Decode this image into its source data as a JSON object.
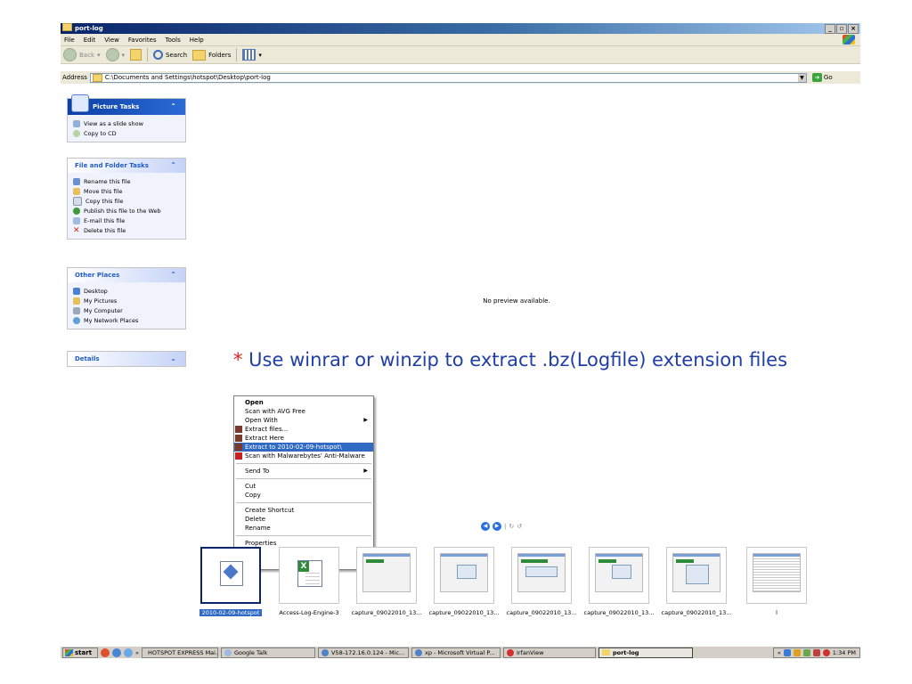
{
  "window": {
    "title": "port-log",
    "controls": [
      "_",
      "×"
    ]
  },
  "menu": [
    "File",
    "Edit",
    "View",
    "Favorites",
    "Tools",
    "Help"
  ],
  "toolbar": {
    "back": "Back",
    "search": "Search",
    "folders": "Folders"
  },
  "address": {
    "label": "Address",
    "path": "C:\\Documents and Settings\\hotspot\\Desktop\\port-log",
    "go": "Go"
  },
  "picture_tasks": {
    "title": "Picture Tasks",
    "items": [
      "View as a slide show",
      "Copy to CD"
    ]
  },
  "file_tasks": {
    "title": "File and Folder Tasks",
    "items": [
      "Rename this file",
      "Move this file",
      "Copy this file",
      "Publish this file to the Web",
      "E-mail this file",
      "Delete this file"
    ]
  },
  "other_places": {
    "title": "Other Places",
    "items": [
      "Desktop",
      "My Pictures",
      "My Computer",
      "My Network Places"
    ]
  },
  "details": {
    "title": "Details"
  },
  "preview": {
    "text": "No preview available."
  },
  "instruction": {
    "star": "*",
    "text": " Use winrar or winzip to extract .bz(Logfile) extension files"
  },
  "context_menu": {
    "open": "Open",
    "scan_avg": "Scan with AVG Free",
    "open_with": "Open With",
    "extract_files": "Extract files...",
    "extract_here": "Extract Here",
    "extract_to": "Extract to 2010-02-09-hotspot\\",
    "scan_malware": "Scan with Malwarebytes' Anti-Malware",
    "send_to": "Send To",
    "cut": "Cut",
    "copy": "Copy",
    "create_shortcut": "Create Shortcut",
    "delete": "Delete",
    "rename": "Rename",
    "properties": "Properties"
  },
  "filmstrip": [
    "2010-02-09-hotspot",
    "Access-Log-Engine-3",
    "capture_09022010_13...",
    "capture_09022010_13...",
    "capture_09022010_13...",
    "capture_09022010_13...",
    "capture_09022010_13...",
    "l"
  ],
  "taskbar": {
    "start": "start",
    "chevron": "»",
    "tasks": [
      "HOTSPOT EXPRESS Mai...",
      "Google Talk",
      "V58-172.16.0.124 - Mic...",
      "xp - Microsoft Virtual P...",
      "IrfanView",
      "port-log"
    ],
    "tray_chevron": "«",
    "clock": "1:34 PM"
  },
  "colors": {
    "title_bar": "#0a246a",
    "selection": "#316ac5",
    "instruction_text": "#1f3ea8",
    "instruction_star": "#e02020"
  }
}
